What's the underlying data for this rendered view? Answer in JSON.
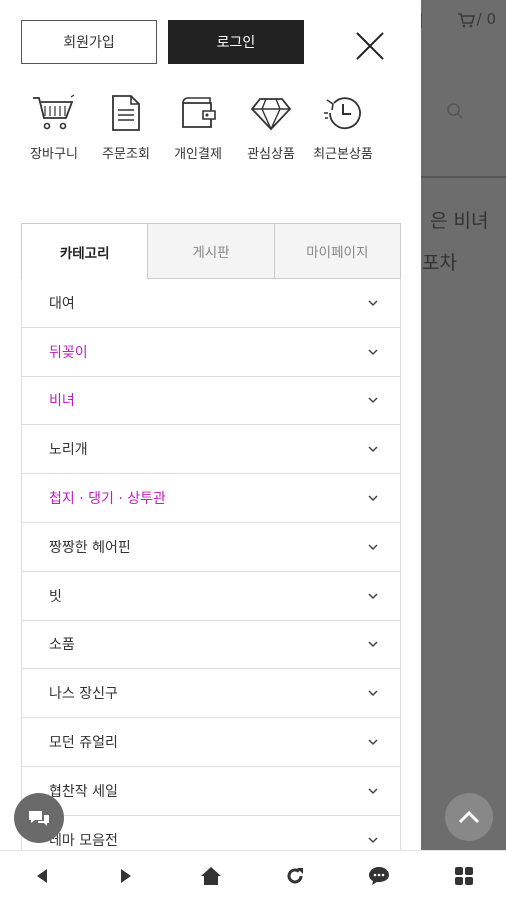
{
  "background": {
    "cart_count": "/ 0",
    "text_line1": "은 비녀",
    "text_line2": "포차"
  },
  "auth": {
    "join_label": "회원가입",
    "login_label": "로그인"
  },
  "quick_links": [
    {
      "label": "장바구니",
      "icon": "cart-icon"
    },
    {
      "label": "주문조회",
      "icon": "document-icon"
    },
    {
      "label": "개인결제",
      "icon": "wallet-icon"
    },
    {
      "label": "관심상품",
      "icon": "diamond-icon"
    },
    {
      "label": "최근본상품",
      "icon": "history-clock-icon"
    }
  ],
  "tabs": [
    {
      "label": "카테고리",
      "active": true
    },
    {
      "label": "게시판",
      "active": false
    },
    {
      "label": "마이페이지",
      "active": false
    }
  ],
  "categories": [
    {
      "label": "대여",
      "highlight": false
    },
    {
      "label": "뒤꽂이",
      "highlight": true
    },
    {
      "label": "비녀",
      "highlight": true
    },
    {
      "label": "노리개",
      "highlight": false
    },
    {
      "label": "첩지 · 댕기 · 상투관",
      "highlight": true
    },
    {
      "label": "짱짱한 헤어핀",
      "highlight": false
    },
    {
      "label": "빗",
      "highlight": false
    },
    {
      "label": "소품",
      "highlight": false
    },
    {
      "label": "나스 장신구",
      "highlight": false
    },
    {
      "label": "모던 쥬얼리",
      "highlight": false
    },
    {
      "label": "협찬작 세일",
      "highlight": false
    },
    {
      "label": "테마 모음전",
      "highlight": false
    }
  ],
  "colors": {
    "highlight": "#c020c0",
    "login_bg": "#222222",
    "overlay": "#6d6d6d"
  }
}
